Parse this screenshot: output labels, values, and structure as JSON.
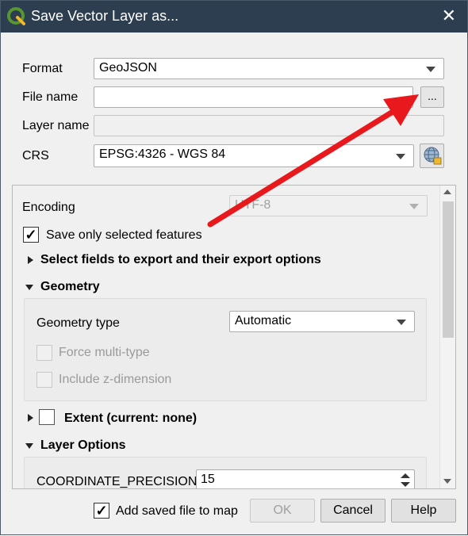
{
  "window": {
    "title": "Save Vector Layer as...",
    "close_glyph": "✕"
  },
  "form": {
    "format_label": "Format",
    "format_value": "GeoJSON",
    "filename_label": "File name",
    "filename_value": "",
    "browse_label": "...",
    "layername_label": "Layer name",
    "layername_value": "",
    "crs_label": "CRS",
    "crs_value": "EPSG:4326 - WGS 84"
  },
  "options": {
    "encoding_label": "Encoding",
    "encoding_value": "UTF-8",
    "save_selected_label": "Save only selected features",
    "save_selected_checked": true,
    "select_fields_label": "Select fields to export and their export options",
    "geometry_label": "Geometry",
    "geometry_type_label": "Geometry type",
    "geometry_type_value": "Automatic",
    "force_multi_label": "Force multi-type",
    "include_z_label": "Include z-dimension",
    "extent_label": "Extent (current: none)",
    "layer_options_label": "Layer Options",
    "coord_precision_label": "COORDINATE_PRECISION",
    "coord_precision_value": "15"
  },
  "footer": {
    "add_to_map_label": "Add saved file to map",
    "add_to_map_checked": true,
    "ok_label": "OK",
    "cancel_label": "Cancel",
    "help_label": "Help"
  },
  "icons": {
    "app_logo": "qgis-logo-icon",
    "crs_selector": "globe-crs-icon",
    "annotation": "red-arrow-annotation"
  },
  "colors": {
    "titlebar": "#2c3e50",
    "annotation_arrow": "#e8191d",
    "qgis_green": "#589632",
    "qgis_yellow": "#f0b82f"
  }
}
